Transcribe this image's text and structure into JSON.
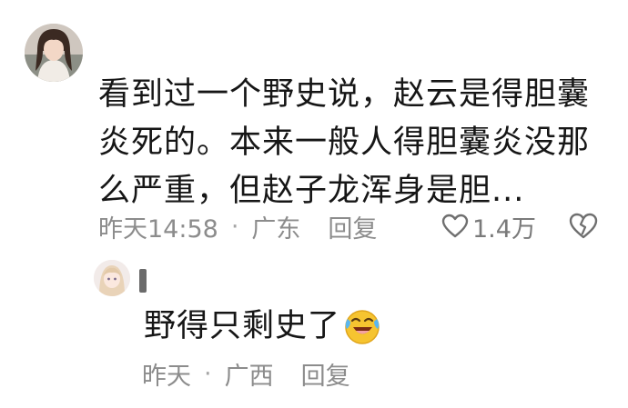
{
  "comment": {
    "text": "看到过一个野史说，赵云是得胆囊炎死的。本来一般人得胆囊炎没那么严重，但赵子龙浑身是胆...",
    "time": "昨天14:58",
    "separator": "·",
    "location": "广东",
    "reply_label": "回复",
    "likes": "1.4万"
  },
  "reply": {
    "text": "野得只剩史了",
    "emoji_icon": "laughing-crying-emoji",
    "time": "昨天",
    "separator": "·",
    "location": "广西",
    "reply_label": "回复"
  }
}
